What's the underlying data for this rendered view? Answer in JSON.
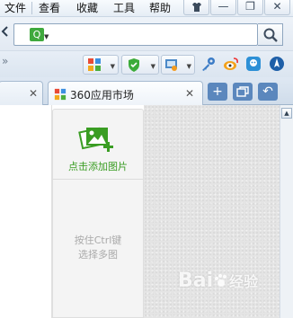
{
  "menu": {
    "items": [
      "文件",
      "查看",
      "收藏",
      "工具",
      "帮助"
    ]
  },
  "window_controls": {
    "skin": "衬衫形换肤",
    "minimize": "—",
    "restore": "❐",
    "close": "✕"
  },
  "address": {
    "value": "",
    "site_icon": "Q",
    "search_icon": "search-icon"
  },
  "toolbar": {
    "overflow": "»"
  },
  "tabs": {
    "items": [
      {
        "title": "",
        "close": "✕"
      },
      {
        "title": "360应用市场",
        "close": "✕"
      }
    ],
    "new_tab": "+",
    "undo": "↶"
  },
  "panel": {
    "upload_label": "点击添加图片",
    "hint_line1": "按住Ctrl键",
    "hint_line2": "选择多图"
  },
  "watermark": {
    "text": "Bai",
    "text2": "经验"
  },
  "colors": {
    "accent_green": "#3a9d23",
    "tab_ctl_blue": "#5b87bd"
  }
}
